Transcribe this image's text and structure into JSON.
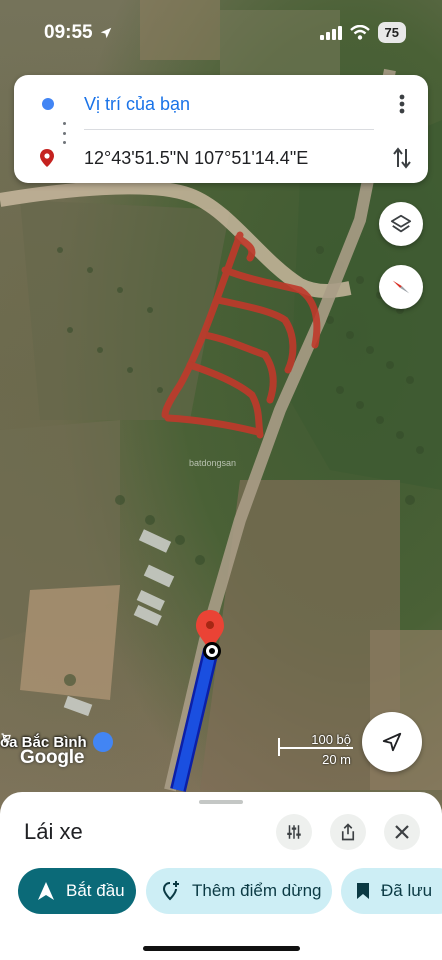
{
  "status_bar": {
    "time": "09:55",
    "battery": "75"
  },
  "route": {
    "origin_label": "Vị trí của bạn",
    "destination_label": "12°43'51.5\"N 107°51'14.4\"E"
  },
  "map": {
    "place_label": "óa Bắc Bình",
    "logo_text": "Google",
    "watermark": "batdongsan",
    "scale": {
      "imperial": "100 bộ",
      "metric": "20 m"
    }
  },
  "sheet": {
    "mode_title": "Lái xe",
    "chips": {
      "start": "Bắt đầu",
      "add_stop": "Thêm điểm dừng",
      "save": "Đã lưu"
    }
  },
  "colors": {
    "accent": "#0b6a78",
    "route_line": "#1a4fe0",
    "pin": "#ea4335",
    "chip_bg": "#cdeef5"
  },
  "icons": [
    "location-arrow-icon",
    "signal-icon",
    "wifi-icon",
    "more-vert-icon",
    "swap-icon",
    "layers-icon",
    "compass-icon",
    "recenter-icon",
    "tune-icon",
    "share-icon",
    "close-icon",
    "navigation-icon",
    "add-stop-icon",
    "bookmark-icon"
  ]
}
